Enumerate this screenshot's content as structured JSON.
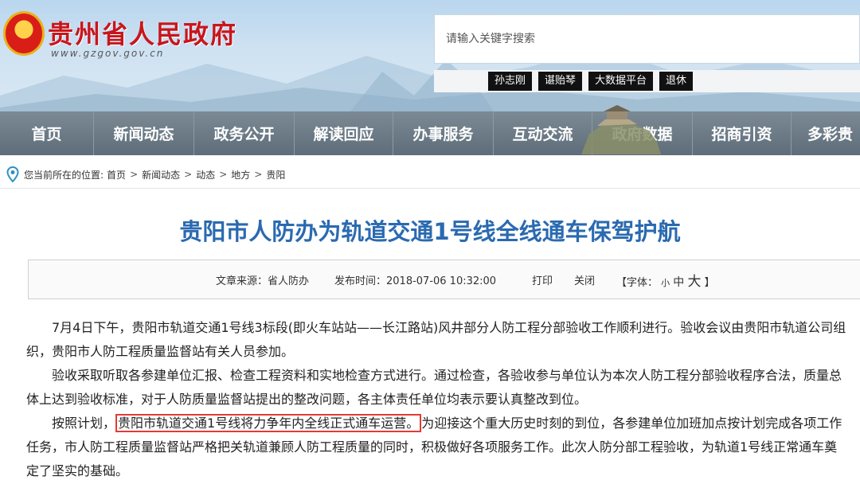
{
  "header": {
    "site_title": "贵州省人民政府",
    "site_url": "www.gzgov.gov.cn",
    "search_placeholder": "请输入关键字搜索",
    "hotwords": [
      "孙志刚",
      "谌贻琴",
      "大数据平台",
      "退休"
    ]
  },
  "nav": {
    "items": [
      "首页",
      "新闻动态",
      "政务公开",
      "解读回应",
      "办事服务",
      "互动交流",
      "政府数据",
      "招商引资",
      "多彩贵"
    ]
  },
  "breadcrumb": {
    "prefix": "您当前所在的位置:",
    "items": [
      "首页",
      "新闻动态",
      "动态",
      "地方",
      "贵阳"
    ],
    "separator": ">"
  },
  "article": {
    "title": "贵阳市人防办为轨道交通1号线全线通车保驾护航",
    "meta": {
      "source": "文章来源：省人防办",
      "time": "发布时间：2018-07-06 10:32:00",
      "print": "打印",
      "close": "关闭",
      "font_label": "【字体：",
      "font_small": "小",
      "font_medium": "中",
      "font_large": "大",
      "font_end": "】"
    },
    "p1": "7月4日下午，贵阳市轨道交通1号线3标段(即火车站站——长江路站)风井部分人防工程分部验收工作顺利进行。验收会议由贵阳市轨道公司组织，贵阳市人防工程质量监督站有关人员参加。",
    "p2": "验收采取听取各参建单位汇报、检查工程资料和实地检查方式进行。通过检查，各验收参与单位认为本次人防工程分部验收程序合法，质量总体上达到验收标准，对于人防质量监督站提出的整改问题，各主体责任单位均表示要认真整改到位。",
    "p3_before": "按照计划，",
    "p3_highlight": "贵阳市轨道交通1号线将力争年内全线正式通车运营。",
    "p3_after": "为迎接这个重大历史时刻的到位，各参建单位加班加点按计划完成各项工作任务，市人防工程质量监督站严格把关轨道兼顾人防工程质量的同时，积极做好各项服务工作。此次人防分部工程验收，为轨道1号线正常通车奠定了坚实的基础。"
  },
  "colors": {
    "title_blue": "#2a6ab0",
    "site_red": "#c8161d",
    "nav_gray": "#5e6d79",
    "highlight_red": "#e23b35"
  }
}
